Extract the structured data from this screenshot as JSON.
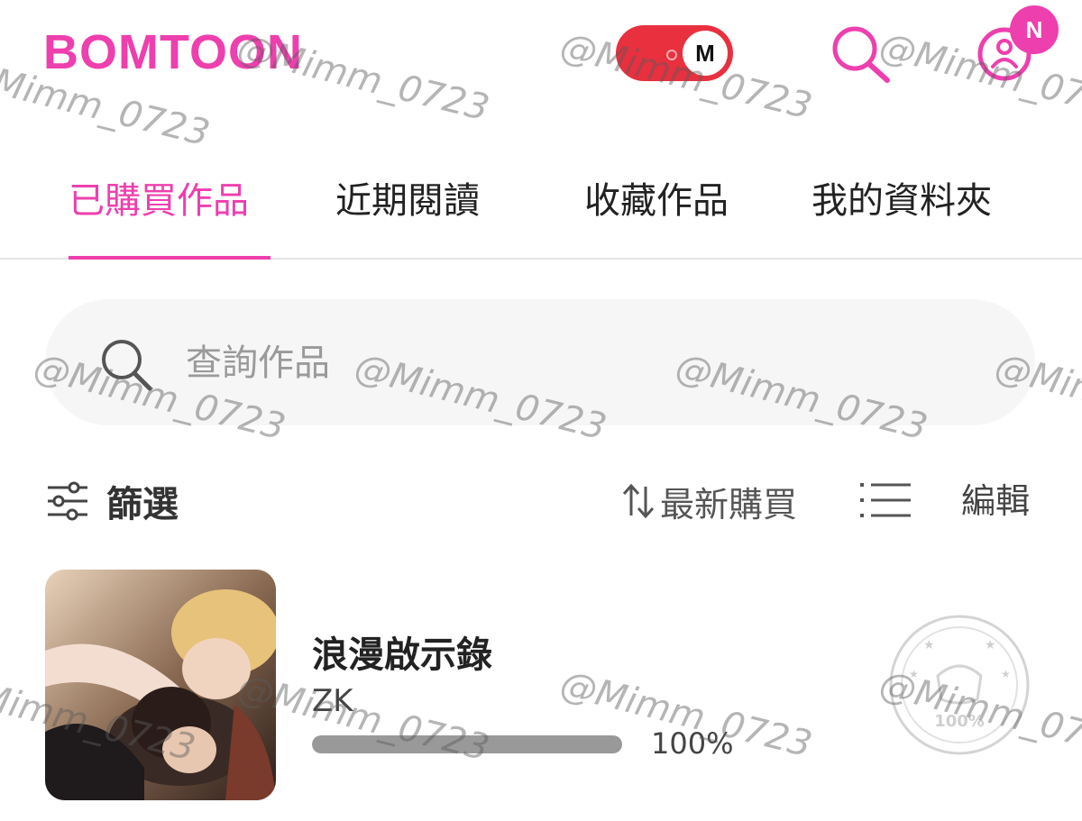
{
  "header": {
    "logo": "BOMTOON",
    "mode_toggle_letter": "M",
    "notification_badge": "N"
  },
  "tabs": [
    {
      "label": "已購買作品",
      "active": true
    },
    {
      "label": "近期閱讀",
      "active": false
    },
    {
      "label": "收藏作品",
      "active": false
    },
    {
      "label": "我的資料夾",
      "active": false
    }
  ],
  "search": {
    "placeholder": "查詢作品",
    "value": ""
  },
  "toolbar": {
    "filter_label": "篩選",
    "sort_label": "最新購買",
    "edit_label": "編輯"
  },
  "items": [
    {
      "title": "浪漫啟示錄",
      "author": "ZK",
      "progress_percent": 100,
      "progress_text": "100%",
      "stamp_text": "100%"
    }
  ],
  "watermark": "@Mimm_0723",
  "colors": {
    "brand": "#ee3fae",
    "toggle": "#e8303f"
  }
}
